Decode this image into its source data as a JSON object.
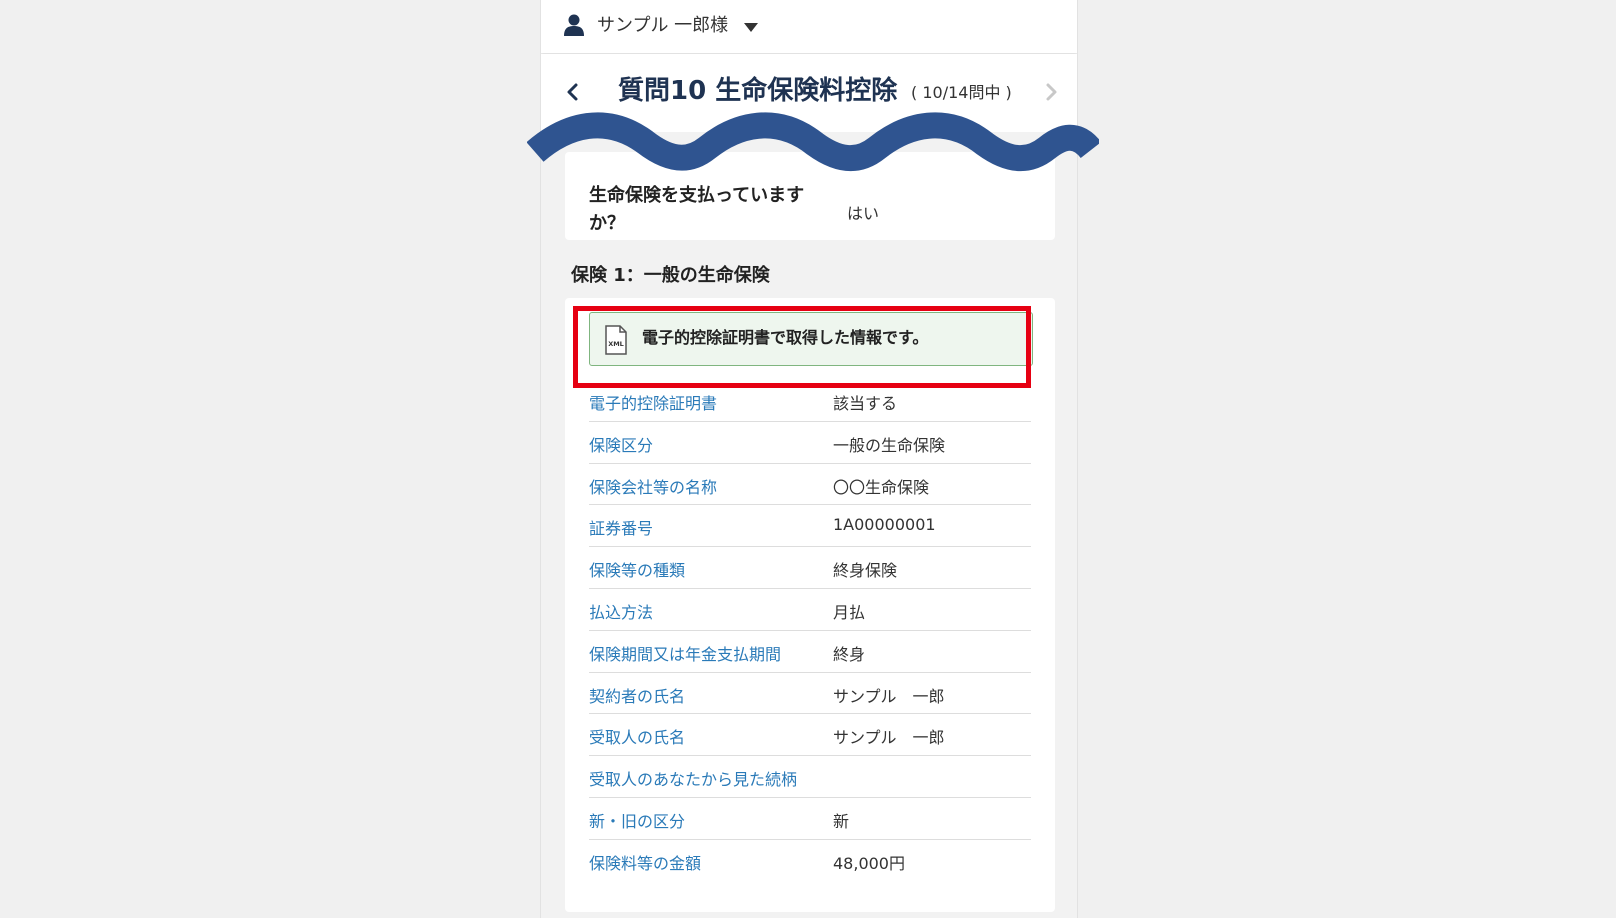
{
  "header": {
    "user_name": "サンプル 一郎様",
    "user_icon": "person-icon",
    "menu_icon": "caret-down-icon"
  },
  "title_bar": {
    "title": "質問10 生命保険料控除",
    "progress": "( 10/14問中 )",
    "back_icon": "chevron-left-icon",
    "forward_icon": "chevron-right-icon"
  },
  "question": {
    "text": "生命保険を支払っていますか？",
    "answer": "はい"
  },
  "section": {
    "title": "保険 1：一般の生命保険"
  },
  "notice": {
    "icon": "xml-file-icon",
    "text": "電子的控除証明書で取得した情報です。"
  },
  "rows": [
    {
      "label": "電子的控除証明書",
      "value": "該当する"
    },
    {
      "label": "保険区分",
      "value": "一般の生命保険"
    },
    {
      "label": "保険会社等の名称",
      "value": "〇〇生命保険"
    },
    {
      "label": "証券番号",
      "value": "1A00000001"
    },
    {
      "label": "保険等の種類",
      "value": "終身保険"
    },
    {
      "label": "払込方法",
      "value": "月払"
    },
    {
      "label": "保険期間又は年金支払期間",
      "value": "終身"
    },
    {
      "label": "契約者の氏名",
      "value": "サンプル　一郎"
    },
    {
      "label": "受取人の氏名",
      "value": "サンプル　一郎"
    },
    {
      "label": "受取人のあなたから見た続柄",
      "value": ""
    },
    {
      "label": "新・旧の区分",
      "value": "新"
    },
    {
      "label": "保険料等の金額",
      "value": "48,000円"
    }
  ],
  "colors": {
    "title": "#1f3352",
    "link": "#2a7ab8",
    "highlight": "#e60012",
    "wave": "#2f5490",
    "notice_bg": "#eef6ee"
  }
}
